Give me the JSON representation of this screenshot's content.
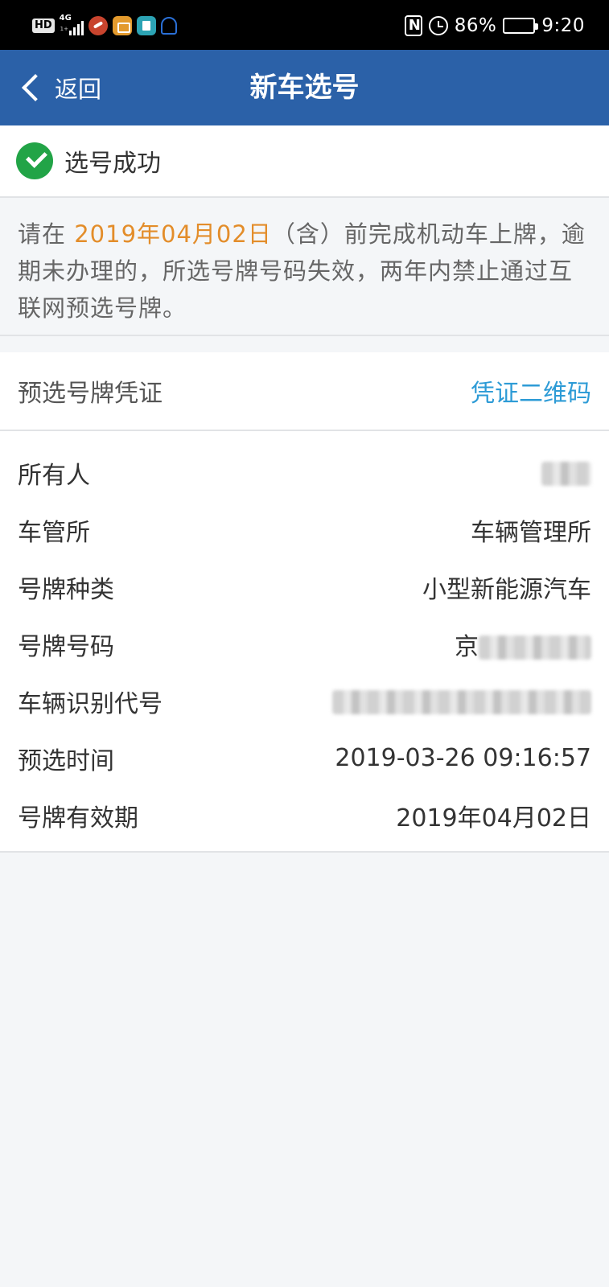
{
  "status_bar": {
    "hd": "HD",
    "network": "4G",
    "network_sub": "1+",
    "battery": "86%",
    "time": "9:20",
    "battery_level": 0.86
  },
  "nav": {
    "back_label": "返回",
    "title": "新车选号"
  },
  "success": {
    "text": "选号成功"
  },
  "notice": {
    "prefix": "请在 ",
    "date": "2019年04月02日",
    "suffix": "（含）前完成机动车上牌，逾期未办理的，所选号牌号码失效，两年内禁止通过互联网预选号牌。"
  },
  "certificate": {
    "label": "预选号牌凭证",
    "link": "凭证二维码"
  },
  "info": [
    {
      "label": "所有人",
      "value": ""
    },
    {
      "label": "车管所",
      "value": "车辆管理所"
    },
    {
      "label": "号牌种类",
      "value": "小型新能源汽车"
    },
    {
      "label": "号牌号码",
      "value": "京"
    },
    {
      "label": "车辆识别代号",
      "value": ""
    },
    {
      "label": "预选时间",
      "value": "2019-03-26 09:16:57"
    },
    {
      "label": "号牌有效期",
      "value": "2019年04月02日"
    }
  ],
  "colors": {
    "nav_bg": "#2b61a8",
    "success_green": "#22a447",
    "date_orange": "#e38d2a",
    "link_blue": "#2d9bd6"
  }
}
